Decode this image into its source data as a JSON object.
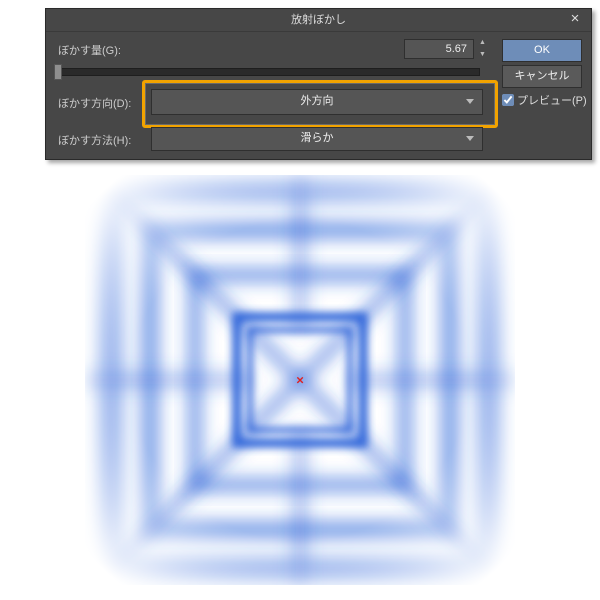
{
  "dialog": {
    "title": "放射ぼかし",
    "amount_label": "ぼかす量(G):",
    "amount_value": "5.67",
    "direction_label": "ぼかす方向(D):",
    "direction_value": "外方向",
    "method_label": "ぼかす方法(H):",
    "method_value": "滑らか",
    "ok_label": "OK",
    "cancel_label": "キャンセル",
    "preview_label": "プレビュー(P)",
    "preview_checked": true
  },
  "icons": {
    "close": "×",
    "up": "▲",
    "down": "▼",
    "center_marker": "×"
  }
}
